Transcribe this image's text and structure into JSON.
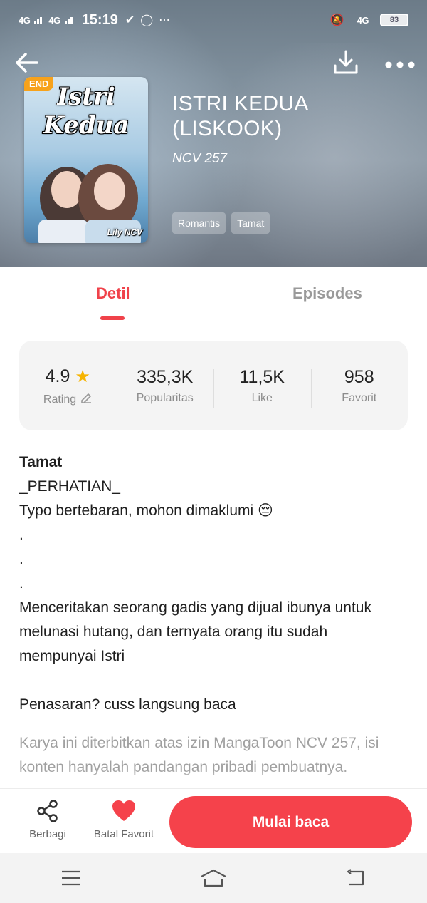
{
  "status_bar": {
    "network1": "4G",
    "network2": "4G",
    "time": "15:19",
    "network3": "4G",
    "battery": "83"
  },
  "book": {
    "cover_title": "Istri Kedua",
    "cover_author": "Lily NCV",
    "badge": "END",
    "title": "ISTRI KEDUA (LISKOOK)",
    "author": "NCV 257",
    "tags": [
      "Romantis",
      "Tamat"
    ]
  },
  "tabs": [
    {
      "label": "Detil",
      "active": true
    },
    {
      "label": "Episodes",
      "active": false
    }
  ],
  "stats": [
    {
      "value": "4.9",
      "label": "Rating"
    },
    {
      "value": "335,3K",
      "label": "Popularitas"
    },
    {
      "value": "11,5K",
      "label": "Like"
    },
    {
      "value": "958",
      "label": "Favorit"
    }
  ],
  "description": {
    "status": "Tamat",
    "lines": [
      "_PERHATIAN_",
      "Typo bertebaran, mohon dimaklumi 😔",
      ".",
      ".",
      ".",
      "Menceritakan seorang gadis yang dijual ibunya untuk melunasi hutang, dan ternyata orang itu sudah mempunyai Istri"
    ],
    "tease": "Penasaran? cuss langsung baca",
    "footer": "Karya ini diterbitkan atas izin MangaToon NCV 257, isi konten hanyalah pandangan pribadi pembuatnya."
  },
  "actions": {
    "share": "Berbagi",
    "favorite": "Batal Favorit",
    "read": "Mulai baca"
  },
  "colors": {
    "accent": "#f5424b",
    "star": "#f6b400",
    "badge": "#f7a21b"
  }
}
